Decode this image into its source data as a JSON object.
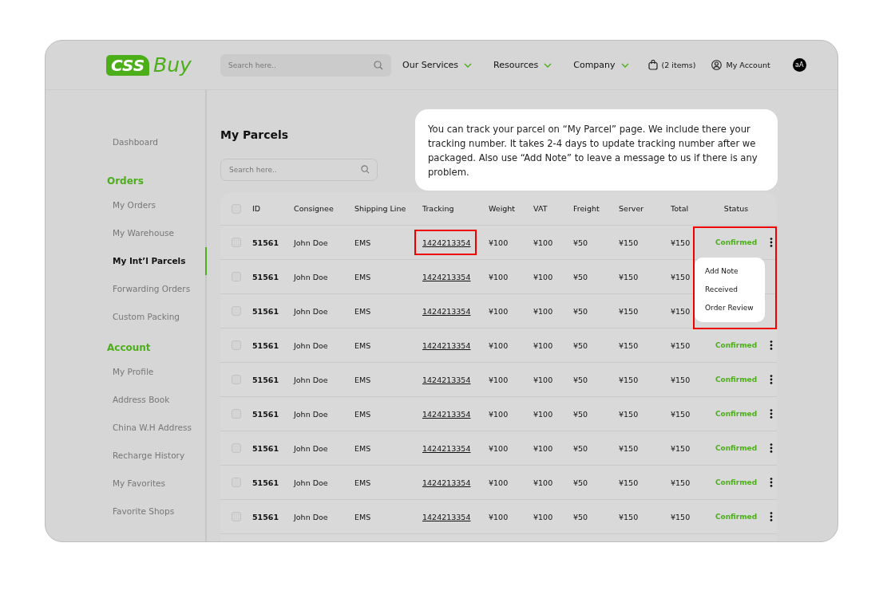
{
  "header": {
    "logo": {
      "box": "CSS",
      "word": "Buy"
    },
    "search": {
      "placeholder": "Search here.."
    },
    "nav": [
      {
        "label": "Our Services"
      },
      {
        "label": "Resources"
      },
      {
        "label": "Company"
      }
    ],
    "cart": "(2 items)",
    "account": "My Account",
    "avatar": "aA"
  },
  "sidebar": {
    "items": [
      {
        "kind": "link",
        "label": "Dashboard",
        "selected": false
      },
      {
        "kind": "heading",
        "label": "Orders"
      },
      {
        "kind": "link",
        "label": "My Orders",
        "selected": false
      },
      {
        "kind": "link",
        "label": "My Warehouse",
        "selected": false
      },
      {
        "kind": "link",
        "label": "My Int’l Parcels",
        "selected": true
      },
      {
        "kind": "link",
        "label": "Forwarding Orders",
        "selected": false
      },
      {
        "kind": "link",
        "label": "Custom Packing",
        "selected": false
      },
      {
        "kind": "heading",
        "label": "Account"
      },
      {
        "kind": "link",
        "label": "My Profile",
        "selected": false
      },
      {
        "kind": "link",
        "label": "Address Book",
        "selected": false
      },
      {
        "kind": "link",
        "label": "China W.H Address",
        "selected": false
      },
      {
        "kind": "link",
        "label": "Recharge History",
        "selected": false
      },
      {
        "kind": "link",
        "label": "My Favorites",
        "selected": false
      },
      {
        "kind": "link",
        "label": "Favorite Shops",
        "selected": false
      }
    ]
  },
  "page_title": "My Parcels",
  "search": {
    "placeholder": "Search here.."
  },
  "tooltip": "You can track your parcel on “My Parcel” page. We include there your tracking number. It takes 2-4 days to update tracking number after we packaged.  Also use “Add Note” to leave a message to us if there is any problem.",
  "table": {
    "all_checked": false,
    "columns": [
      "ID",
      "Consignee",
      "Shipping Line",
      "Tracking",
      "Weight",
      "VAT",
      "Freight",
      "Server",
      "Total",
      "Status"
    ],
    "rows": [
      {
        "checked": false,
        "highlighted": true,
        "id": "51561",
        "consignee": "John Doe",
        "shipping_line": "EMS",
        "tracking": "1424213354",
        "weight": "¥100",
        "vat": "¥100",
        "freight": "¥50",
        "server": "¥150",
        "total": "¥150",
        "status": "Confirmed",
        "menu": [
          "Add Note",
          "Received",
          "Order Review"
        ]
      },
      {
        "checked": false,
        "highlighted": false,
        "id": "51561",
        "consignee": "John Doe",
        "shipping_line": "EMS",
        "tracking": "1424213354",
        "weight": "¥100",
        "vat": "¥100",
        "freight": "¥50",
        "server": "¥150",
        "total": "¥150"
      },
      {
        "checked": false,
        "highlighted": false,
        "id": "51561",
        "consignee": "John Doe",
        "shipping_line": "EMS",
        "tracking": "1424213354",
        "weight": "¥100",
        "vat": "¥100",
        "freight": "¥50",
        "server": "¥150",
        "total": "¥150"
      },
      {
        "checked": false,
        "highlighted": false,
        "id": "51561",
        "consignee": "John Doe",
        "shipping_line": "EMS",
        "tracking": "1424213354",
        "weight": "¥100",
        "vat": "¥100",
        "freight": "¥50",
        "server": "¥150",
        "total": "¥150",
        "status": "Confirmed"
      },
      {
        "checked": false,
        "highlighted": false,
        "id": "51561",
        "consignee": "John Doe",
        "shipping_line": "EMS",
        "tracking": "1424213354",
        "weight": "¥100",
        "vat": "¥100",
        "freight": "¥50",
        "server": "¥150",
        "total": "¥150",
        "status": "Confirmed"
      },
      {
        "checked": false,
        "highlighted": false,
        "id": "51561",
        "consignee": "John Doe",
        "shipping_line": "EMS",
        "tracking": "1424213354",
        "weight": "¥100",
        "vat": "¥100",
        "freight": "¥50",
        "server": "¥150",
        "total": "¥150",
        "status": "Confirmed"
      },
      {
        "checked": false,
        "highlighted": false,
        "id": "51561",
        "consignee": "John Doe",
        "shipping_line": "EMS",
        "tracking": "1424213354",
        "weight": "¥100",
        "vat": "¥100",
        "freight": "¥50",
        "server": "¥150",
        "total": "¥150",
        "status": "Confirmed"
      },
      {
        "checked": false,
        "highlighted": false,
        "id": "51561",
        "consignee": "John Doe",
        "shipping_line": "EMS",
        "tracking": "1424213354",
        "weight": "¥100",
        "vat": "¥100",
        "freight": "¥50",
        "server": "¥150",
        "total": "¥150",
        "status": "Confirmed"
      },
      {
        "checked": false,
        "highlighted": false,
        "id": "51561",
        "consignee": "John Doe",
        "shipping_line": "EMS",
        "tracking": "1424213354",
        "weight": "¥100",
        "vat": "¥100",
        "freight": "¥50",
        "server": "¥150",
        "total": "¥150",
        "status": "Confirmed"
      }
    ]
  }
}
